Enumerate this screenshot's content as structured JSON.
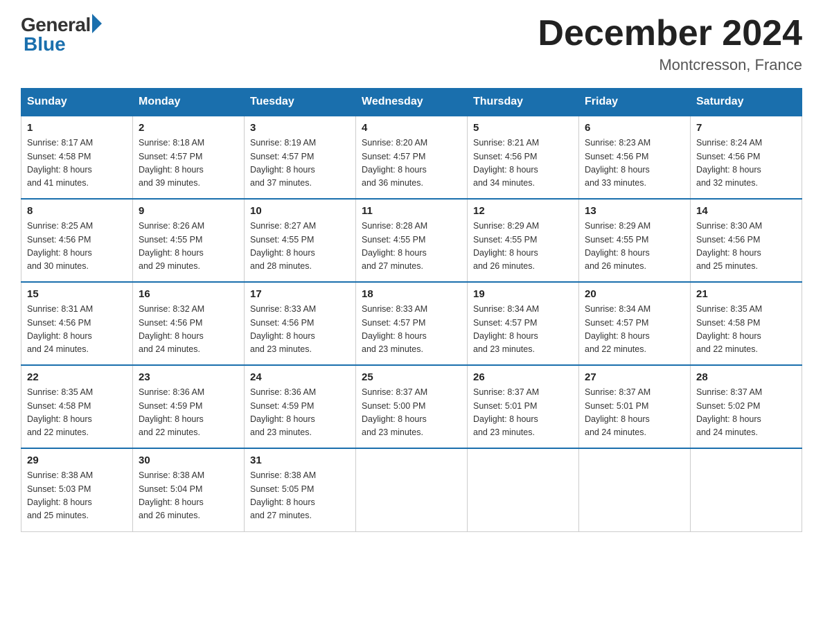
{
  "header": {
    "logo_general": "General",
    "logo_blue": "Blue",
    "title": "December 2024",
    "location": "Montcresson, France"
  },
  "days_of_week": [
    "Sunday",
    "Monday",
    "Tuesday",
    "Wednesday",
    "Thursday",
    "Friday",
    "Saturday"
  ],
  "weeks": [
    [
      {
        "day": "1",
        "sunrise": "8:17 AM",
        "sunset": "4:58 PM",
        "daylight": "8 hours and 41 minutes."
      },
      {
        "day": "2",
        "sunrise": "8:18 AM",
        "sunset": "4:57 PM",
        "daylight": "8 hours and 39 minutes."
      },
      {
        "day": "3",
        "sunrise": "8:19 AM",
        "sunset": "4:57 PM",
        "daylight": "8 hours and 37 minutes."
      },
      {
        "day": "4",
        "sunrise": "8:20 AM",
        "sunset": "4:57 PM",
        "daylight": "8 hours and 36 minutes."
      },
      {
        "day": "5",
        "sunrise": "8:21 AM",
        "sunset": "4:56 PM",
        "daylight": "8 hours and 34 minutes."
      },
      {
        "day": "6",
        "sunrise": "8:23 AM",
        "sunset": "4:56 PM",
        "daylight": "8 hours and 33 minutes."
      },
      {
        "day": "7",
        "sunrise": "8:24 AM",
        "sunset": "4:56 PM",
        "daylight": "8 hours and 32 minutes."
      }
    ],
    [
      {
        "day": "8",
        "sunrise": "8:25 AM",
        "sunset": "4:56 PM",
        "daylight": "8 hours and 30 minutes."
      },
      {
        "day": "9",
        "sunrise": "8:26 AM",
        "sunset": "4:55 PM",
        "daylight": "8 hours and 29 minutes."
      },
      {
        "day": "10",
        "sunrise": "8:27 AM",
        "sunset": "4:55 PM",
        "daylight": "8 hours and 28 minutes."
      },
      {
        "day": "11",
        "sunrise": "8:28 AM",
        "sunset": "4:55 PM",
        "daylight": "8 hours and 27 minutes."
      },
      {
        "day": "12",
        "sunrise": "8:29 AM",
        "sunset": "4:55 PM",
        "daylight": "8 hours and 26 minutes."
      },
      {
        "day": "13",
        "sunrise": "8:29 AM",
        "sunset": "4:55 PM",
        "daylight": "8 hours and 26 minutes."
      },
      {
        "day": "14",
        "sunrise": "8:30 AM",
        "sunset": "4:56 PM",
        "daylight": "8 hours and 25 minutes."
      }
    ],
    [
      {
        "day": "15",
        "sunrise": "8:31 AM",
        "sunset": "4:56 PM",
        "daylight": "8 hours and 24 minutes."
      },
      {
        "day": "16",
        "sunrise": "8:32 AM",
        "sunset": "4:56 PM",
        "daylight": "8 hours and 24 minutes."
      },
      {
        "day": "17",
        "sunrise": "8:33 AM",
        "sunset": "4:56 PM",
        "daylight": "8 hours and 23 minutes."
      },
      {
        "day": "18",
        "sunrise": "8:33 AM",
        "sunset": "4:57 PM",
        "daylight": "8 hours and 23 minutes."
      },
      {
        "day": "19",
        "sunrise": "8:34 AM",
        "sunset": "4:57 PM",
        "daylight": "8 hours and 23 minutes."
      },
      {
        "day": "20",
        "sunrise": "8:34 AM",
        "sunset": "4:57 PM",
        "daylight": "8 hours and 22 minutes."
      },
      {
        "day": "21",
        "sunrise": "8:35 AM",
        "sunset": "4:58 PM",
        "daylight": "8 hours and 22 minutes."
      }
    ],
    [
      {
        "day": "22",
        "sunrise": "8:35 AM",
        "sunset": "4:58 PM",
        "daylight": "8 hours and 22 minutes."
      },
      {
        "day": "23",
        "sunrise": "8:36 AM",
        "sunset": "4:59 PM",
        "daylight": "8 hours and 22 minutes."
      },
      {
        "day": "24",
        "sunrise": "8:36 AM",
        "sunset": "4:59 PM",
        "daylight": "8 hours and 23 minutes."
      },
      {
        "day": "25",
        "sunrise": "8:37 AM",
        "sunset": "5:00 PM",
        "daylight": "8 hours and 23 minutes."
      },
      {
        "day": "26",
        "sunrise": "8:37 AM",
        "sunset": "5:01 PM",
        "daylight": "8 hours and 23 minutes."
      },
      {
        "day": "27",
        "sunrise": "8:37 AM",
        "sunset": "5:01 PM",
        "daylight": "8 hours and 24 minutes."
      },
      {
        "day": "28",
        "sunrise": "8:37 AM",
        "sunset": "5:02 PM",
        "daylight": "8 hours and 24 minutes."
      }
    ],
    [
      {
        "day": "29",
        "sunrise": "8:38 AM",
        "sunset": "5:03 PM",
        "daylight": "8 hours and 25 minutes."
      },
      {
        "day": "30",
        "sunrise": "8:38 AM",
        "sunset": "5:04 PM",
        "daylight": "8 hours and 26 minutes."
      },
      {
        "day": "31",
        "sunrise": "8:38 AM",
        "sunset": "5:05 PM",
        "daylight": "8 hours and 27 minutes."
      },
      null,
      null,
      null,
      null
    ]
  ],
  "labels": {
    "sunrise": "Sunrise:",
    "sunset": "Sunset:",
    "daylight": "Daylight:"
  }
}
